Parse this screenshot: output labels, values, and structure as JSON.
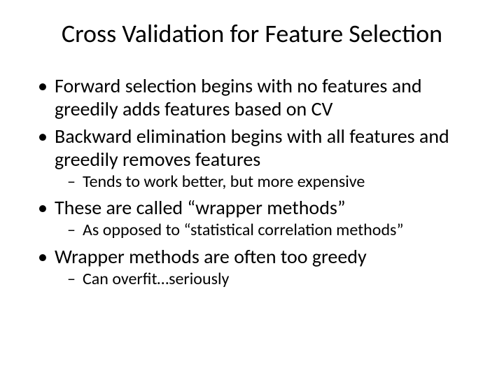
{
  "title": "Cross Validation for Feature Selection",
  "bullets": [
    {
      "text": "Forward selection begins with no features and greedily adds features based on CV",
      "sub": []
    },
    {
      "text": "Backward elimination begins with all features and greedily removes features",
      "sub": [
        "Tends to work better, but more expensive"
      ]
    },
    {
      "text": "These are called “wrapper methods”",
      "sub": [
        "As opposed to “statistical correlation methods”"
      ]
    },
    {
      "text": "Wrapper methods are often too greedy",
      "sub": [
        "Can overfit…seriously"
      ]
    }
  ]
}
